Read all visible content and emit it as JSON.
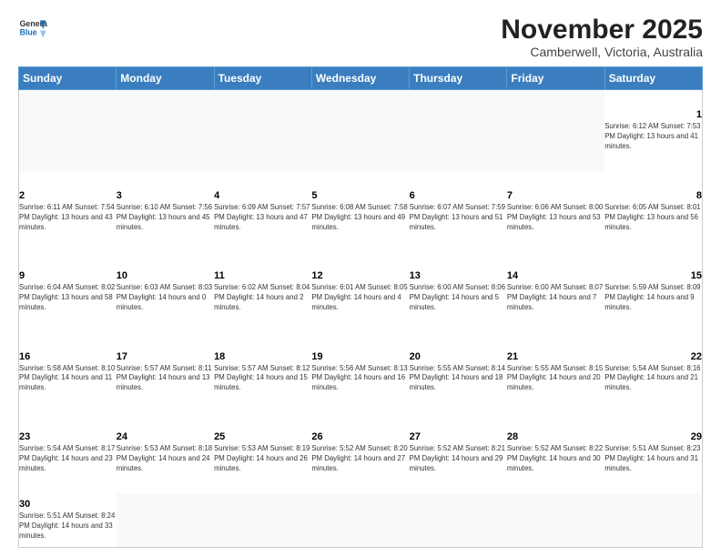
{
  "header": {
    "logo_general": "General",
    "logo_blue": "Blue",
    "title": "November 2025",
    "subtitle": "Camberwell, Victoria, Australia"
  },
  "days_of_week": [
    "Sunday",
    "Monday",
    "Tuesday",
    "Wednesday",
    "Thursday",
    "Friday",
    "Saturday"
  ],
  "weeks": [
    [
      {
        "day": "",
        "info": ""
      },
      {
        "day": "",
        "info": ""
      },
      {
        "day": "",
        "info": ""
      },
      {
        "day": "",
        "info": ""
      },
      {
        "day": "",
        "info": ""
      },
      {
        "day": "",
        "info": ""
      },
      {
        "day": "1",
        "info": "Sunrise: 6:12 AM\nSunset: 7:53 PM\nDaylight: 13 hours and 41 minutes."
      }
    ],
    [
      {
        "day": "2",
        "info": "Sunrise: 6:11 AM\nSunset: 7:54 PM\nDaylight: 13 hours and 43 minutes."
      },
      {
        "day": "3",
        "info": "Sunrise: 6:10 AM\nSunset: 7:56 PM\nDaylight: 13 hours and 45 minutes."
      },
      {
        "day": "4",
        "info": "Sunrise: 6:09 AM\nSunset: 7:57 PM\nDaylight: 13 hours and 47 minutes."
      },
      {
        "day": "5",
        "info": "Sunrise: 6:08 AM\nSunset: 7:58 PM\nDaylight: 13 hours and 49 minutes."
      },
      {
        "day": "6",
        "info": "Sunrise: 6:07 AM\nSunset: 7:59 PM\nDaylight: 13 hours and 51 minutes."
      },
      {
        "day": "7",
        "info": "Sunrise: 6:06 AM\nSunset: 8:00 PM\nDaylight: 13 hours and 53 minutes."
      },
      {
        "day": "8",
        "info": "Sunrise: 6:05 AM\nSunset: 8:01 PM\nDaylight: 13 hours and 56 minutes."
      }
    ],
    [
      {
        "day": "9",
        "info": "Sunrise: 6:04 AM\nSunset: 8:02 PM\nDaylight: 13 hours and 58 minutes."
      },
      {
        "day": "10",
        "info": "Sunrise: 6:03 AM\nSunset: 8:03 PM\nDaylight: 14 hours and 0 minutes."
      },
      {
        "day": "11",
        "info": "Sunrise: 6:02 AM\nSunset: 8:04 PM\nDaylight: 14 hours and 2 minutes."
      },
      {
        "day": "12",
        "info": "Sunrise: 6:01 AM\nSunset: 8:05 PM\nDaylight: 14 hours and 4 minutes."
      },
      {
        "day": "13",
        "info": "Sunrise: 6:00 AM\nSunset: 8:06 PM\nDaylight: 14 hours and 5 minutes."
      },
      {
        "day": "14",
        "info": "Sunrise: 6:00 AM\nSunset: 8:07 PM\nDaylight: 14 hours and 7 minutes."
      },
      {
        "day": "15",
        "info": "Sunrise: 5:59 AM\nSunset: 8:09 PM\nDaylight: 14 hours and 9 minutes."
      }
    ],
    [
      {
        "day": "16",
        "info": "Sunrise: 5:58 AM\nSunset: 8:10 PM\nDaylight: 14 hours and 11 minutes."
      },
      {
        "day": "17",
        "info": "Sunrise: 5:57 AM\nSunset: 8:11 PM\nDaylight: 14 hours and 13 minutes."
      },
      {
        "day": "18",
        "info": "Sunrise: 5:57 AM\nSunset: 8:12 PM\nDaylight: 14 hours and 15 minutes."
      },
      {
        "day": "19",
        "info": "Sunrise: 5:56 AM\nSunset: 8:13 PM\nDaylight: 14 hours and 16 minutes."
      },
      {
        "day": "20",
        "info": "Sunrise: 5:55 AM\nSunset: 8:14 PM\nDaylight: 14 hours and 18 minutes."
      },
      {
        "day": "21",
        "info": "Sunrise: 5:55 AM\nSunset: 8:15 PM\nDaylight: 14 hours and 20 minutes."
      },
      {
        "day": "22",
        "info": "Sunrise: 5:54 AM\nSunset: 8:16 PM\nDaylight: 14 hours and 21 minutes."
      }
    ],
    [
      {
        "day": "23",
        "info": "Sunrise: 5:54 AM\nSunset: 8:17 PM\nDaylight: 14 hours and 23 minutes."
      },
      {
        "day": "24",
        "info": "Sunrise: 5:53 AM\nSunset: 8:18 PM\nDaylight: 14 hours and 24 minutes."
      },
      {
        "day": "25",
        "info": "Sunrise: 5:53 AM\nSunset: 8:19 PM\nDaylight: 14 hours and 26 minutes."
      },
      {
        "day": "26",
        "info": "Sunrise: 5:52 AM\nSunset: 8:20 PM\nDaylight: 14 hours and 27 minutes."
      },
      {
        "day": "27",
        "info": "Sunrise: 5:52 AM\nSunset: 8:21 PM\nDaylight: 14 hours and 29 minutes."
      },
      {
        "day": "28",
        "info": "Sunrise: 5:52 AM\nSunset: 8:22 PM\nDaylight: 14 hours and 30 minutes."
      },
      {
        "day": "29",
        "info": "Sunrise: 5:51 AM\nSunset: 8:23 PM\nDaylight: 14 hours and 31 minutes."
      }
    ],
    [
      {
        "day": "30",
        "info": "Sunrise: 5:51 AM\nSunset: 8:24 PM\nDaylight: 14 hours and 33 minutes."
      },
      {
        "day": "",
        "info": ""
      },
      {
        "day": "",
        "info": ""
      },
      {
        "day": "",
        "info": ""
      },
      {
        "day": "",
        "info": ""
      },
      {
        "day": "",
        "info": ""
      },
      {
        "day": "",
        "info": ""
      }
    ]
  ]
}
